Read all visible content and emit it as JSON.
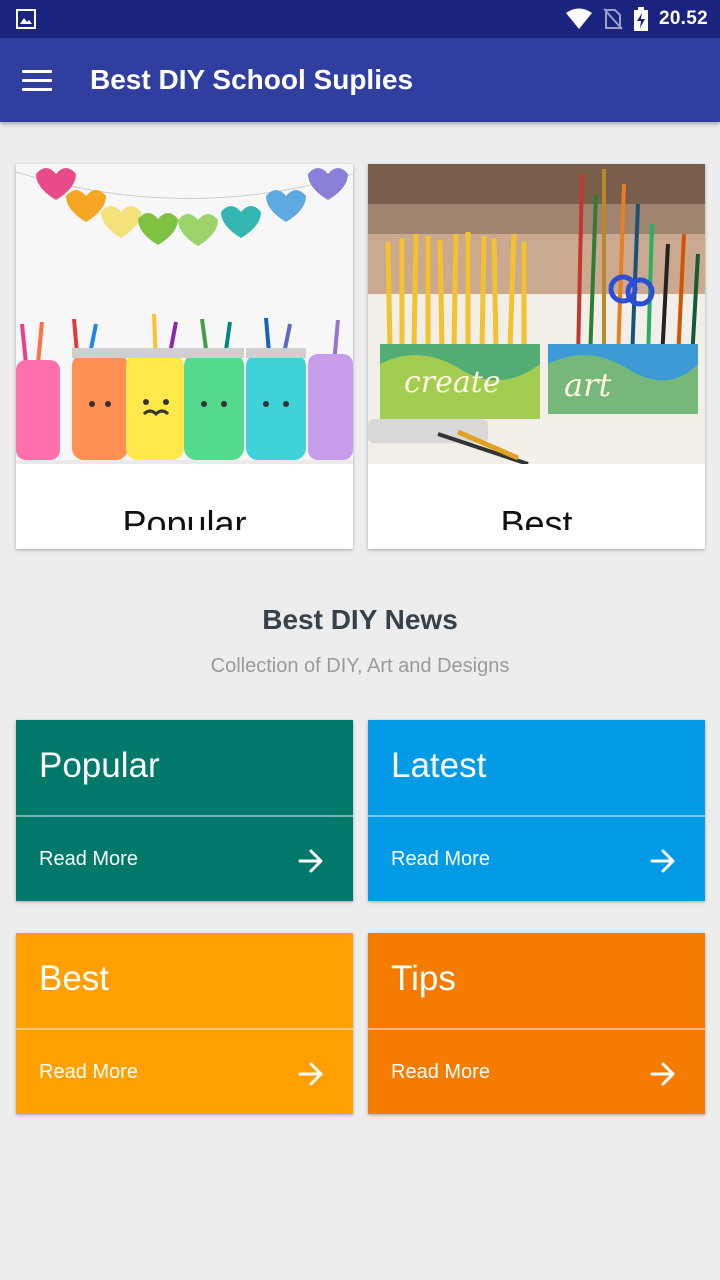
{
  "status_bar": {
    "time": "20.52"
  },
  "app_bar": {
    "title": "Best DIY School Suplies"
  },
  "image_cards": [
    {
      "caption": "Popular"
    },
    {
      "caption": "Best"
    }
  ],
  "section": {
    "title": "Best DIY News",
    "subtitle": "Collection of DIY, Art and Designs"
  },
  "tiles": [
    {
      "title": "Popular",
      "action": "Read More",
      "color": "#00796b"
    },
    {
      "title": "Latest",
      "action": "Read More",
      "color": "#039be5"
    },
    {
      "title": "Best",
      "action": "Read More",
      "color": "#ffa000"
    },
    {
      "title": "Tips",
      "action": "Read More",
      "color": "#f57c00"
    }
  ],
  "colors": {
    "status_bar": "#1a237e",
    "app_bar": "#303f9f",
    "background": "#ededed"
  }
}
